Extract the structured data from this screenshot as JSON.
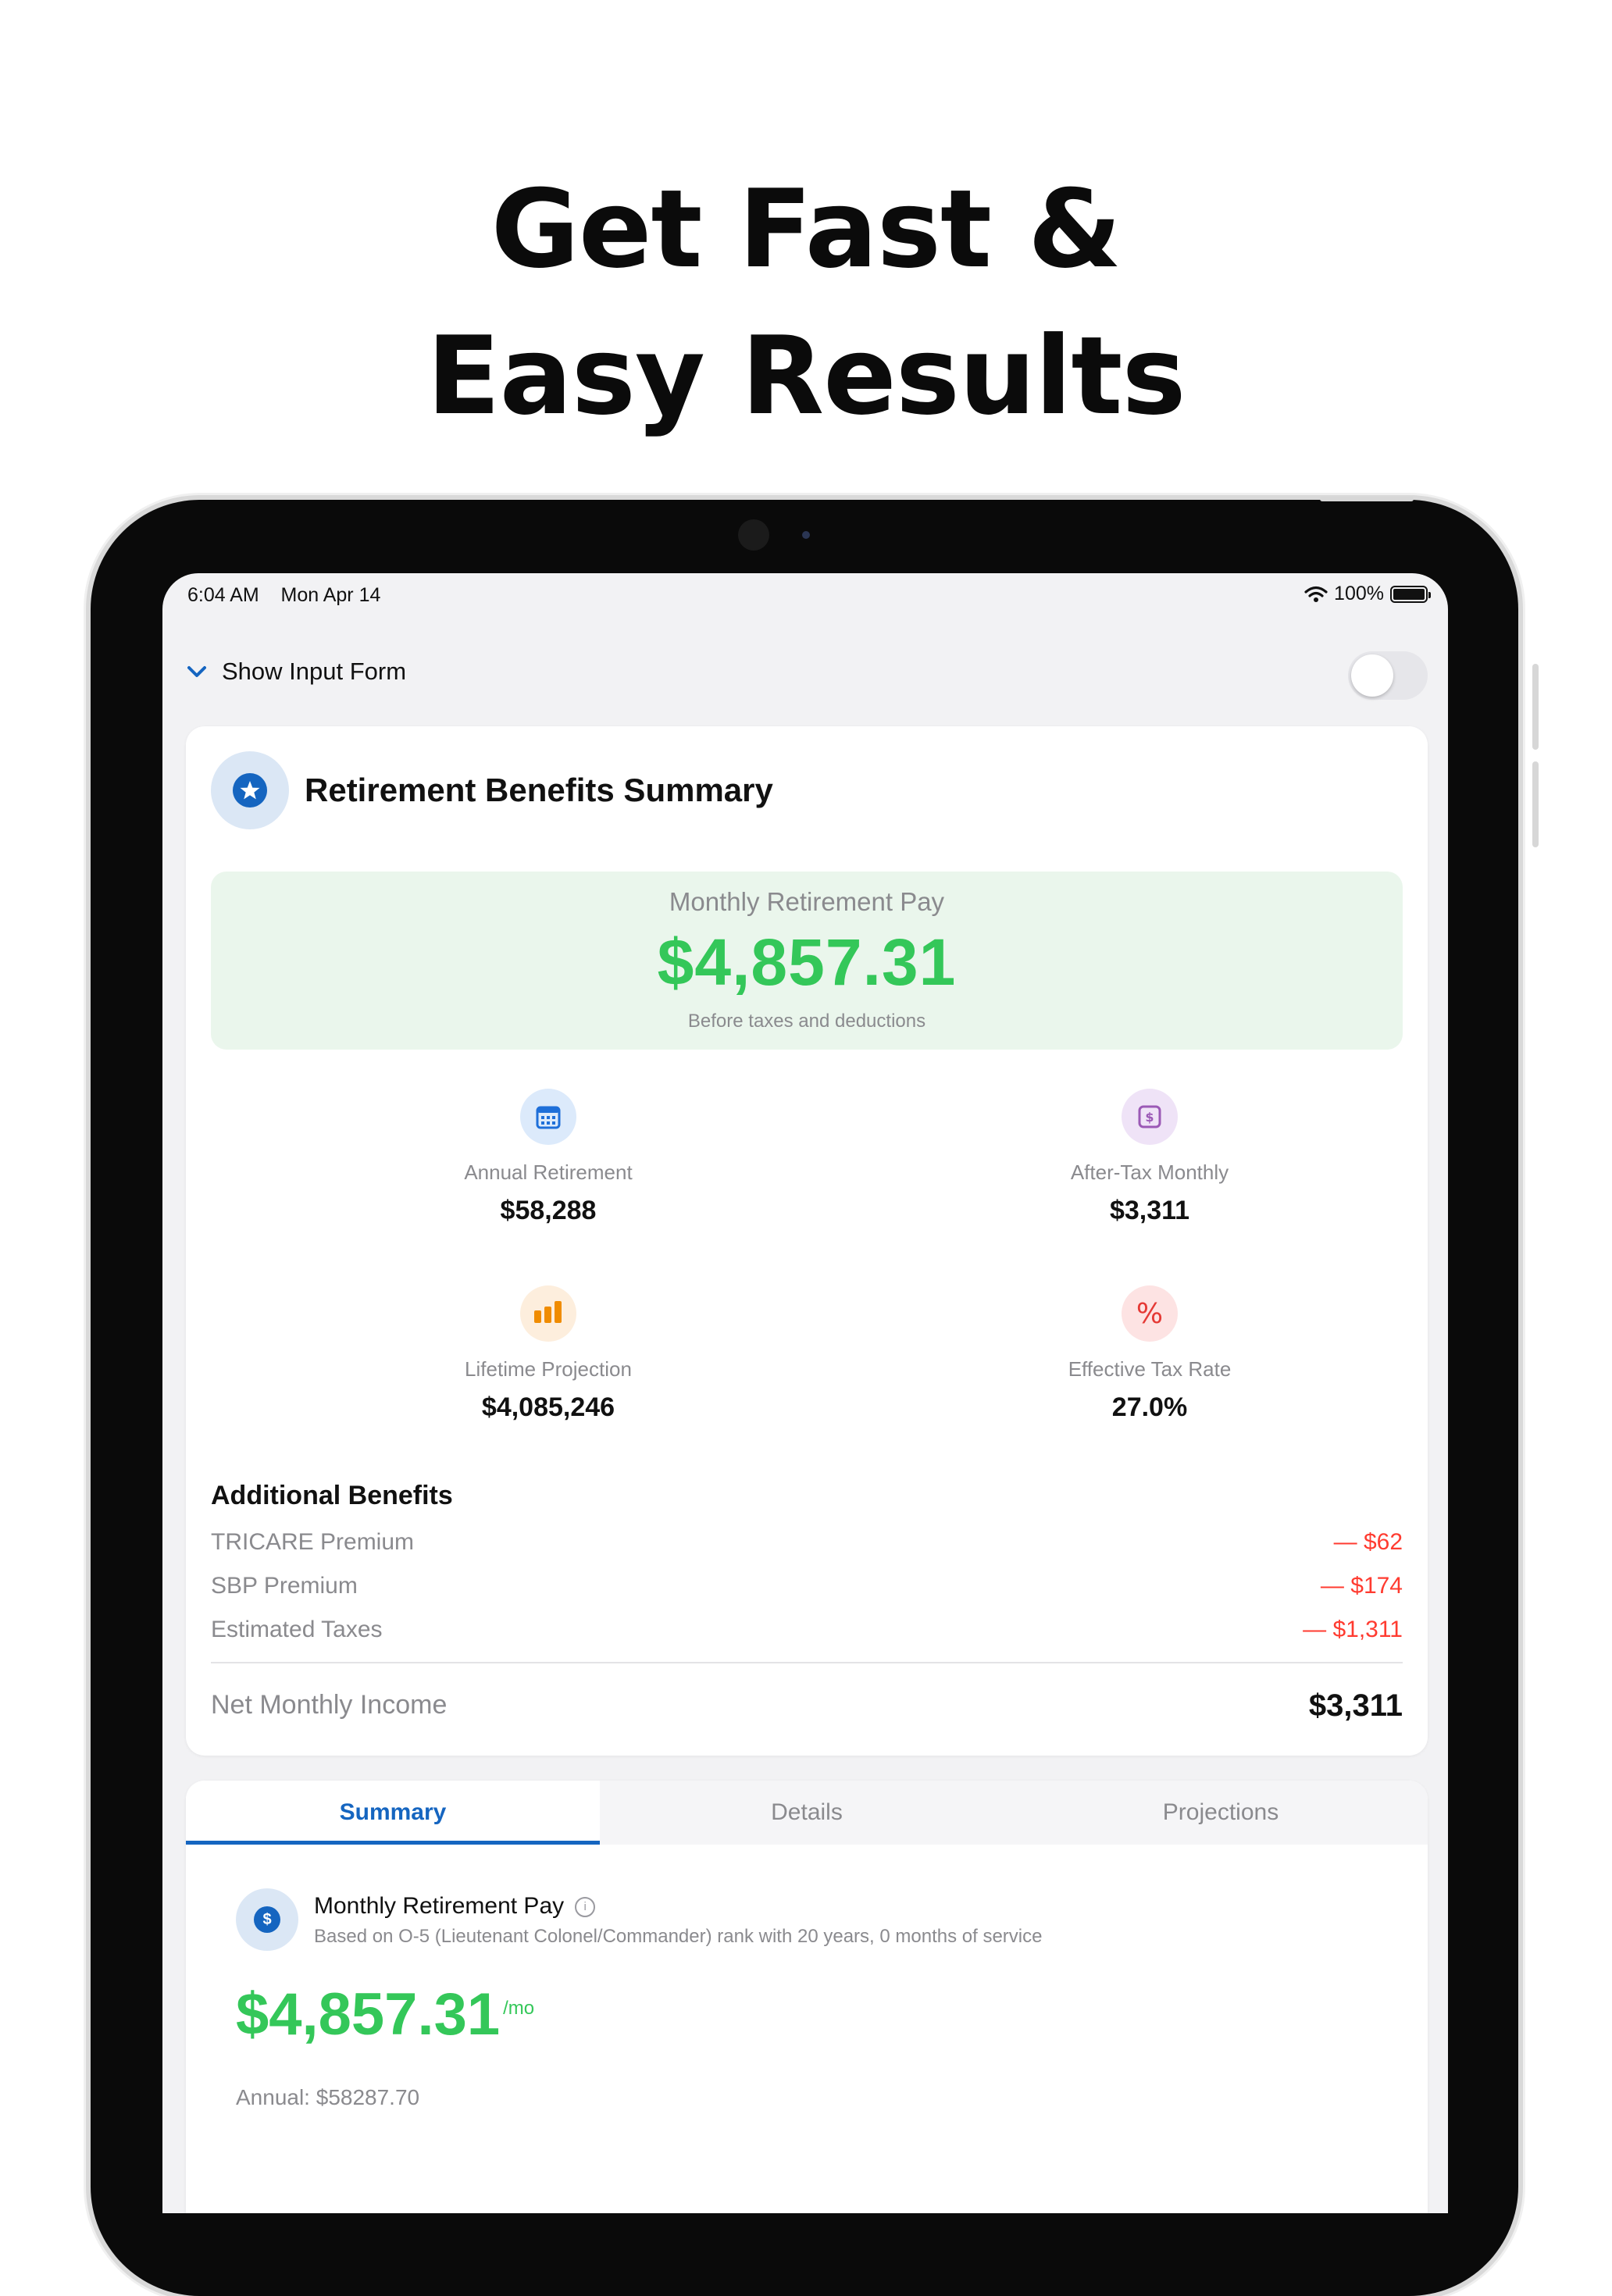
{
  "headline": {
    "line1": "Get Fast &",
    "line2": "Easy Results"
  },
  "status_bar": {
    "time": "6:04 AM",
    "date": "Mon Apr 14",
    "battery": "100%"
  },
  "input_form": {
    "label": "Show Input Form",
    "toggle_on": false
  },
  "summary": {
    "title": "Retirement Benefits Summary",
    "hero_label": "Monthly Retirement Pay",
    "hero_value": "$4,857.31",
    "hero_sub": "Before taxes and deductions",
    "stats": [
      {
        "label": "Annual Retirement",
        "value": "$58,288",
        "icon": "calendar-icon",
        "color": "#1e6fd9",
        "bg": "#dceafb"
      },
      {
        "label": "After-Tax Monthly",
        "value": "$3,311",
        "icon": "dollar-icon",
        "color": "#9b59b6",
        "bg": "#efe3f7"
      },
      {
        "label": "Lifetime Projection",
        "value": "$4,085,246",
        "icon": "bar-chart-icon",
        "color": "#f08c00",
        "bg": "#fdeedd"
      },
      {
        "label": "Effective Tax Rate",
        "value": "27.0%",
        "icon": "percent-icon",
        "color": "#e53935",
        "bg": "#fde3e3"
      }
    ]
  },
  "additional_benefits": {
    "title": "Additional Benefits",
    "rows": [
      {
        "label": "TRICARE Premium",
        "amount": "— $62"
      },
      {
        "label": "SBP Premium",
        "amount": "— $174"
      },
      {
        "label": "Estimated Taxes",
        "amount": "— $1,311"
      }
    ],
    "net_label": "Net Monthly Income",
    "net_value": "$3,311"
  },
  "tabs": [
    {
      "label": "Summary",
      "active": true
    },
    {
      "label": "Details",
      "active": false
    },
    {
      "label": "Projections",
      "active": false
    }
  ],
  "pay_detail": {
    "title": "Monthly Retirement Pay",
    "icon_glyph": "$",
    "info_glyph": "i",
    "subtitle": "Based on O-5 (Lieutenant Colonel/Commander) rank with 20 years, 0 months of service",
    "value": "$4,857.31",
    "per": "/mo",
    "annual": "Annual: $58287.70"
  },
  "colors": {
    "accent": "#1565c0",
    "positive": "#34c759",
    "negative": "#ff3b30"
  }
}
